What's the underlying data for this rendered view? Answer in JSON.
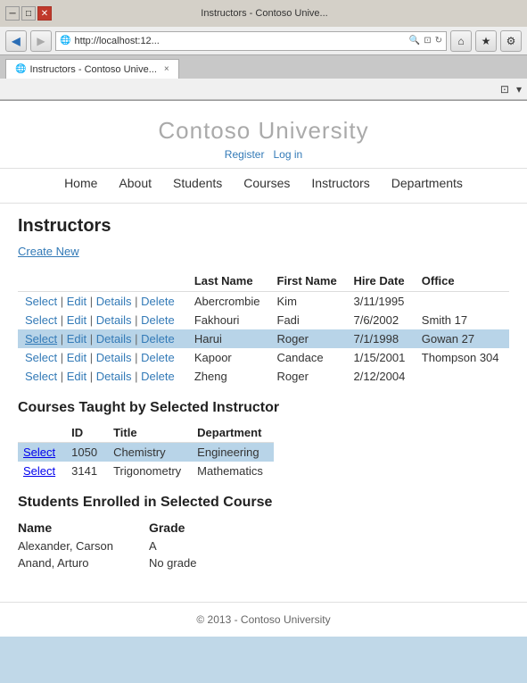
{
  "browser": {
    "title_bar": "Instructors - Contoso Unive...",
    "address": "http://localhost:12...",
    "tab_label": "Instructors - Contoso Unive...",
    "tab_close": "×",
    "win_min": "─",
    "win_max": "□",
    "win_close": "✕",
    "back_icon": "◀",
    "forward_icon": "▶",
    "home_icon": "⌂",
    "star_icon": "★",
    "gear_icon": "⚙",
    "search_icon": "🔍",
    "refresh_icon": "↻",
    "compat_icon": "⊡",
    "tools_icon1": "⌂",
    "tools_icon2": "★",
    "tools_icon3": "⚙"
  },
  "site": {
    "title": "Contoso University",
    "register": "Register",
    "login": "Log in",
    "nav": [
      "Home",
      "About",
      "Students",
      "Courses",
      "Instructors",
      "Departments"
    ]
  },
  "page": {
    "heading": "Instructors",
    "create_new": "Create New"
  },
  "instructors_table": {
    "columns": [
      "",
      "Last Name",
      "First Name",
      "Hire Date",
      "Office"
    ],
    "rows": [
      {
        "actions": [
          "Select",
          "Edit",
          "Details",
          "Delete"
        ],
        "last_name": "Abercrombie",
        "first_name": "Kim",
        "hire_date": "3/11/1995",
        "office": "",
        "selected": false
      },
      {
        "actions": [
          "Select",
          "Edit",
          "Details",
          "Delete"
        ],
        "last_name": "Fakhouri",
        "first_name": "Fadi",
        "hire_date": "7/6/2002",
        "office": "Smith 17",
        "selected": false
      },
      {
        "actions": [
          "Select",
          "Edit",
          "Details",
          "Delete"
        ],
        "last_name": "Harui",
        "first_name": "Roger",
        "hire_date": "7/1/1998",
        "office": "Gowan 27",
        "selected": true
      },
      {
        "actions": [
          "Select",
          "Edit",
          "Details",
          "Delete"
        ],
        "last_name": "Kapoor",
        "first_name": "Candace",
        "hire_date": "1/15/2001",
        "office": "Thompson 304",
        "selected": false
      },
      {
        "actions": [
          "Select",
          "Edit",
          "Details",
          "Delete"
        ],
        "last_name": "Zheng",
        "first_name": "Roger",
        "hire_date": "2/12/2004",
        "office": "",
        "selected": false
      }
    ]
  },
  "courses_section": {
    "heading": "Courses Taught by Selected Instructor",
    "columns": [
      "ID",
      "Title",
      "Department"
    ],
    "rows": [
      {
        "id": "1050",
        "title": "Chemistry",
        "department": "Engineering",
        "selected": true
      },
      {
        "id": "3141",
        "title": "Trigonometry",
        "department": "Mathematics",
        "selected": false
      }
    ]
  },
  "students_section": {
    "heading": "Students Enrolled in Selected Course",
    "columns": [
      "Name",
      "Grade"
    ],
    "rows": [
      {
        "name": "Alexander, Carson",
        "grade": "A"
      },
      {
        "name": "Anand, Arturo",
        "grade": "No grade"
      }
    ]
  },
  "footer": {
    "text": "© 2013 - Contoso University"
  }
}
